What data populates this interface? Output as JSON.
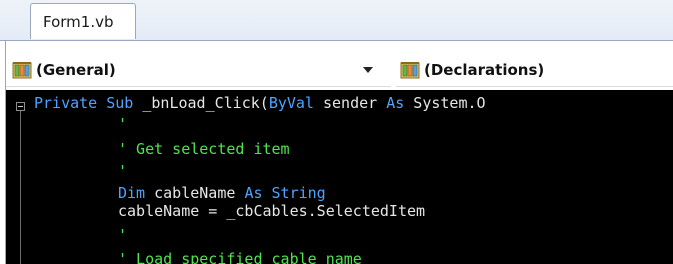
{
  "tabs": [
    {
      "label": "Form1.vb",
      "active": true
    }
  ],
  "navigation": {
    "object_combo": {
      "selected": "(General)",
      "icon": "class-members-icon"
    },
    "member_combo": {
      "selected": "(Declarations)",
      "icon": "class-members-icon"
    }
  },
  "colors": {
    "background": "#000000",
    "keyword": "#4ea3ff",
    "comment": "#4ee44e",
    "text": "#e6e6e6"
  },
  "code": {
    "line1": {
      "kw1": "Private Sub",
      "text1": " _bnLoad_Click(",
      "kw2": "ByVal",
      "text2": " sender ",
      "kw3": "As",
      "text3": " System.O"
    },
    "line2": "'",
    "line3": "' Get selected item",
    "line4": "'",
    "line5": {
      "kw1": "Dim",
      "text1": " cableName ",
      "kw2": "As String"
    },
    "line6": "cableName = _cbCables.SelectedItem",
    "line7": "'",
    "line8": "' Load specified cable name"
  }
}
